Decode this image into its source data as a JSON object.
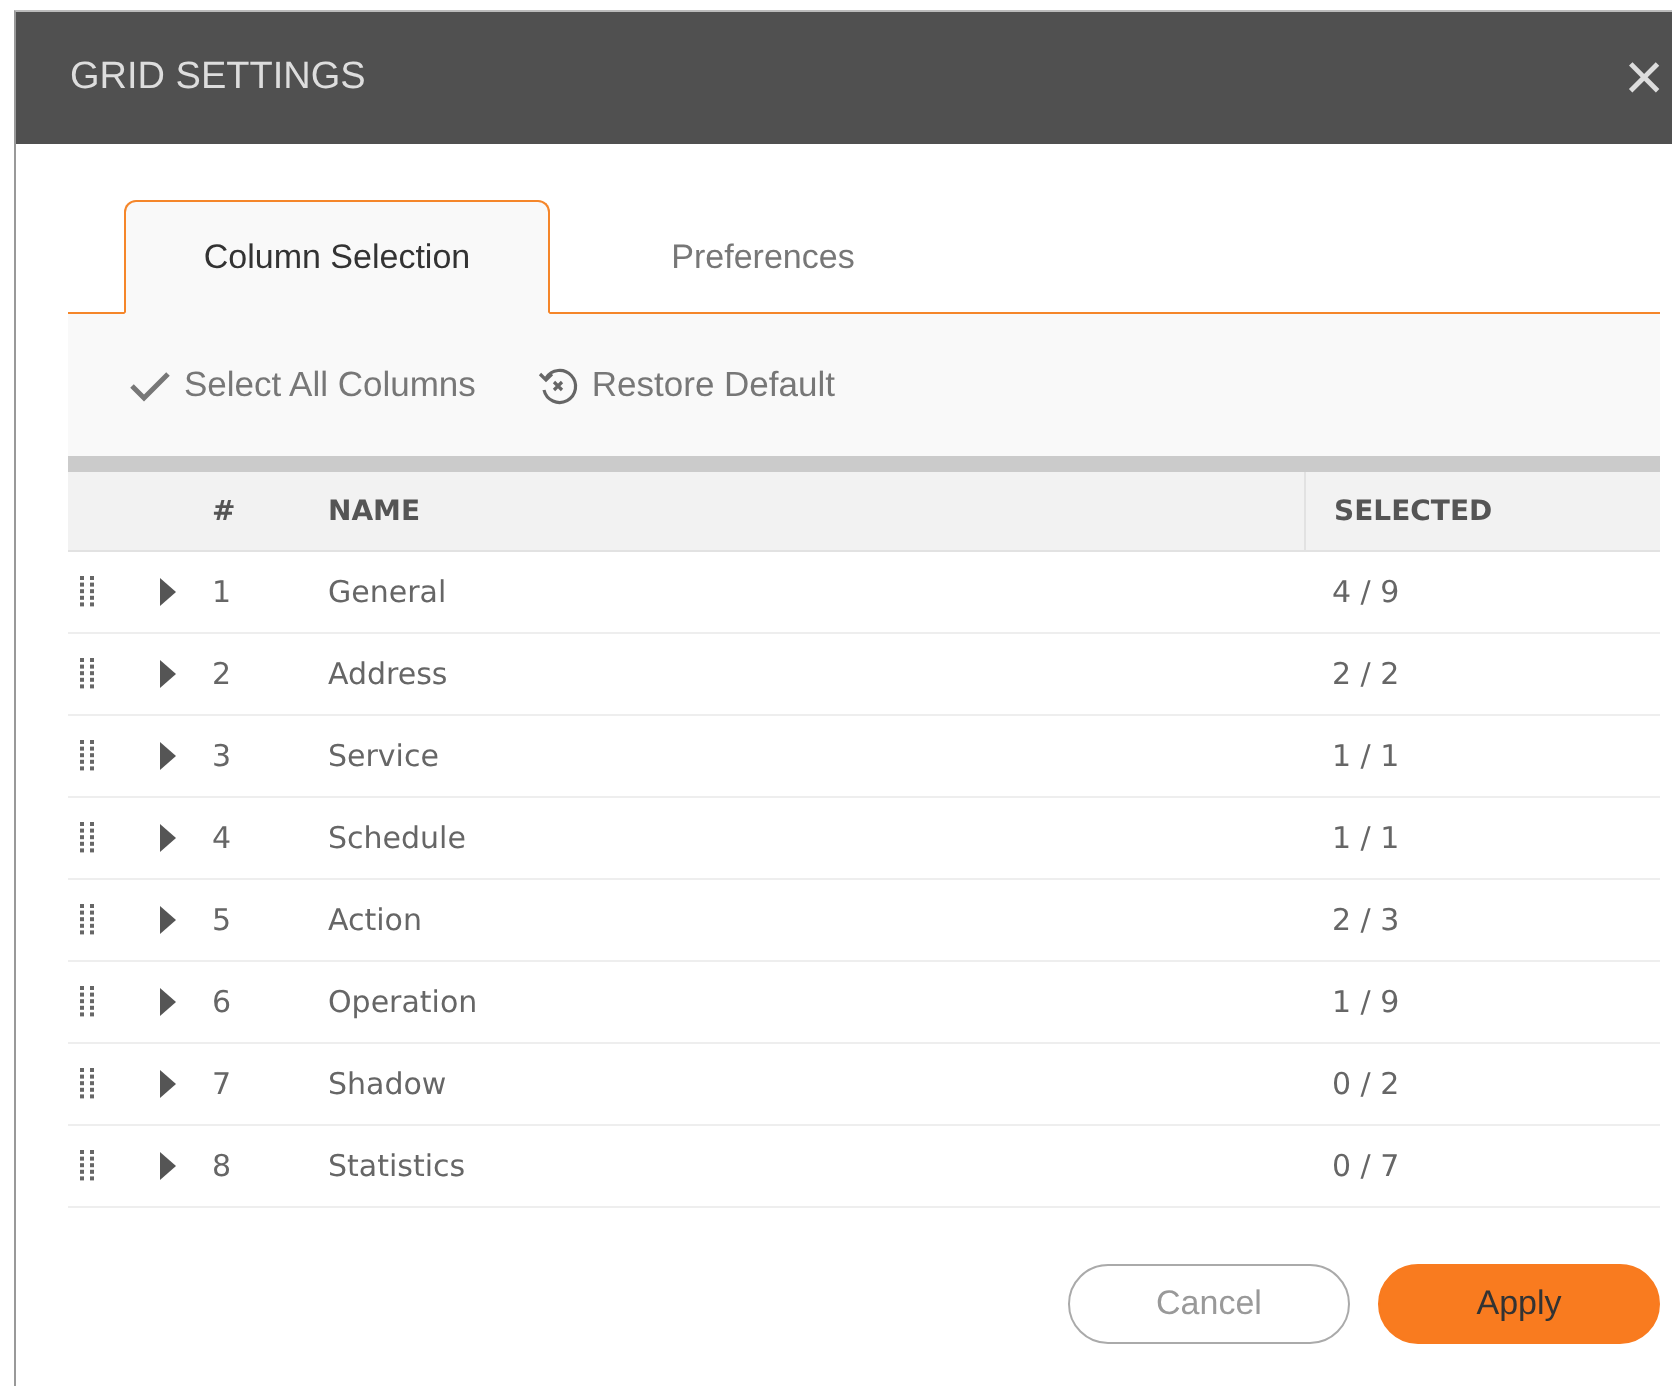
{
  "window": {
    "title": "GRID SETTINGS",
    "close": "×"
  },
  "tabs": [
    {
      "label": "Column Selection",
      "selected": true
    },
    {
      "label": "Preferences",
      "selected": false
    }
  ],
  "toolbar": [
    {
      "kind": "check",
      "label": "Select All Columns"
    },
    {
      "kind": "restore",
      "label": "Restore Default"
    }
  ],
  "table": {
    "columns": [
      "#",
      "NAME",
      "SELECTED"
    ],
    "rows": [
      {
        "number": "1",
        "name": "General",
        "selected": "4 / 9",
        "expanded": false
      },
      {
        "number": "2",
        "name": "Address",
        "selected": "2 / 2",
        "expanded": false
      },
      {
        "number": "3",
        "name": "Service",
        "selected": "1 / 1",
        "expanded": false
      },
      {
        "number": "4",
        "name": "Schedule",
        "selected": "1 / 1",
        "expanded": false
      },
      {
        "number": "5",
        "name": "Action",
        "selected": "2 / 3",
        "expanded": false
      },
      {
        "number": "6",
        "name": "Operation",
        "selected": "1 / 9",
        "expanded": false
      },
      {
        "number": "7",
        "name": "Shadow",
        "selected": "0 / 2",
        "expanded": false
      },
      {
        "number": "8",
        "name": "Statistics",
        "selected": "0 / 7",
        "expanded": false
      }
    ]
  },
  "buttons": [
    {
      "kind": "secondary",
      "label": "Cancel"
    },
    {
      "kind": "primary",
      "label": "Apply"
    }
  ]
}
